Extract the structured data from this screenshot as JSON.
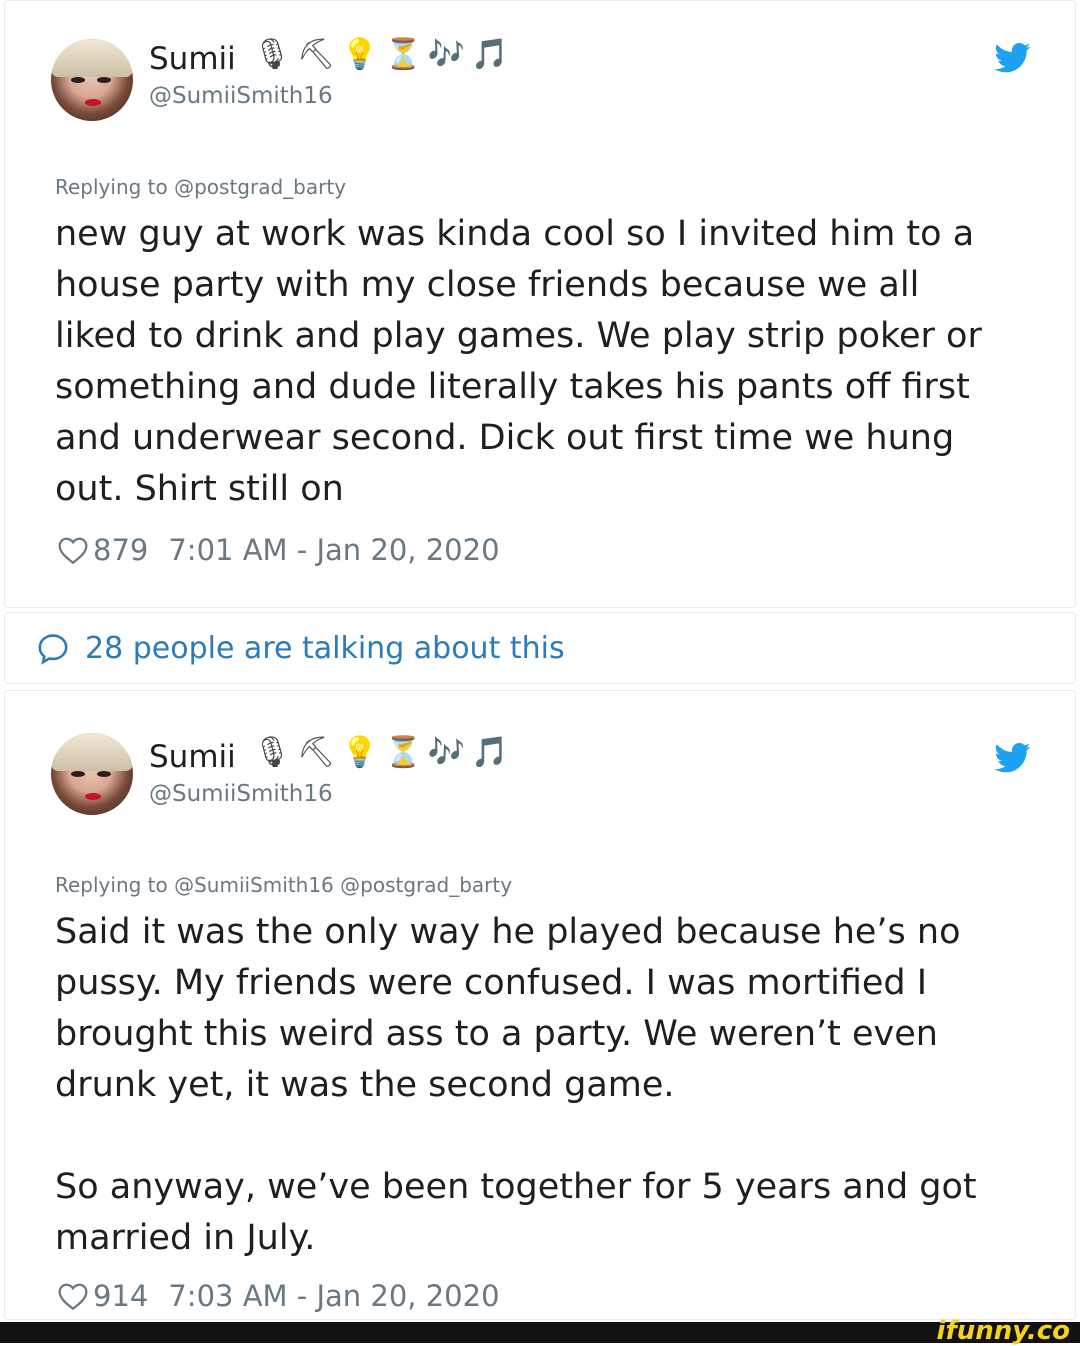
{
  "tweets": [
    {
      "name": "Sumii",
      "emoji": [
        "🎙",
        "⛏",
        "💡",
        "⏳",
        "🎶",
        "🎵"
      ],
      "handle": "@SumiiSmith16",
      "replying": "Replying to @postgrad_barty",
      "text": "new guy at work was kinda cool so I invited him to a\nhouse party with my close friends because we all\nliked to drink and play games. We play strip poker or\nsomething and dude literally takes his pants off first\nand underwear second. Dick out first time we hung\nout. Shirt still on",
      "likes": "879",
      "time": "7:01 AM - Jan 20, 2020"
    },
    {
      "name": "Sumii",
      "emoji": [
        "🎙",
        "⛏",
        "💡",
        "⏳",
        "🎶",
        "🎵"
      ],
      "handle": "@SumiiSmith16",
      "replying": "Replying to @SumiiSmith16 @postgrad_barty",
      "text": "Said it was the only way he played because he’s no\npussy. My friends were confused. I was mortified I\nbrought this weird ass to a party. We weren’t even\ndrunk yet, it was the second game.\n\nSo anyway, we’ve been together for 5 years and got\nmarried in July.",
      "likes": "914",
      "time": "7:03 AM - Jan 20, 2020"
    }
  ],
  "talking": "28 people are talking about this",
  "watermark": "ifunny.co",
  "colors": {
    "accent": "#1da1f2",
    "link": "#2b7bb9",
    "muted": "#697882"
  }
}
